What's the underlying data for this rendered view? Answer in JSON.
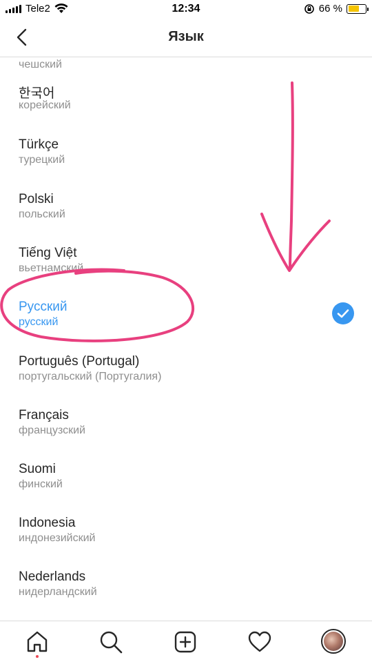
{
  "status_bar": {
    "carrier": "Tele2",
    "time": "12:34",
    "battery_text": "66 %",
    "battery_level": 0.66,
    "battery_color": "#f5c400"
  },
  "header": {
    "title": "Язык",
    "back_icon": "chevron-left-icon"
  },
  "languages": [
    {
      "name": "",
      "native": "чешский"
    },
    {
      "name": "한국어",
      "native": "корейский"
    },
    {
      "name": "Türkçe",
      "native": "турецкий"
    },
    {
      "name": "Polski",
      "native": "польский"
    },
    {
      "name": "Tiếng Việt",
      "native": "вьетнамский"
    },
    {
      "name": "Русский",
      "native": "русский",
      "selected": true
    },
    {
      "name": "Português (Portugal)",
      "native": "португальский (Португалия)"
    },
    {
      "name": "Français",
      "native": "французский"
    },
    {
      "name": "Suomi",
      "native": "финский"
    },
    {
      "name": "Indonesia",
      "native": "индонезийский"
    },
    {
      "name": "Nederlands",
      "native": "нидерландский"
    }
  ],
  "selected_icon": "checkmark-circle-icon",
  "accent_color": "#3897f0",
  "annotation_color": "#e8407f",
  "tab_bar": {
    "items": [
      "home-icon",
      "search-icon",
      "add-post-icon",
      "heart-icon",
      "profile-avatar"
    ],
    "notification_dot_color": "#ed4956"
  }
}
